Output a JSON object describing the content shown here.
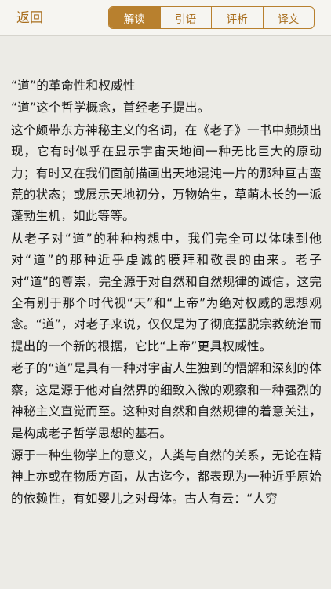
{
  "header": {
    "back_label": "返回",
    "tabs": [
      {
        "label": "解读",
        "active": true
      },
      {
        "label": "引语",
        "active": false
      },
      {
        "label": "评析",
        "active": false
      },
      {
        "label": "译文",
        "active": false
      }
    ]
  },
  "article": {
    "paragraphs": [
      "“道”的革命性和权威性",
      "“道”这个哲学概念，首经老子提出。",
      "这个颇带东方神秘主义的名词，在《老子》一书中频频出现，它有时似乎在显示宇宙天地间一种无比巨大的原动力；有时又在我们面前描画出天地混沌一片的那种亘古蛮荒的状态；或展示天地初分，万物始生，草萌木长的一派蓬勃生机，如此等等。",
      "从老子对“道”的种种构想中，我们完全可以体味到他对“道”的那种近乎虔诚的膜拜和敬畏的由来。老子对“道”的尊崇，完全源于对自然和自然规律的诚信，这完全有别于那个时代视“天”和“上帝”为绝对权威的思想观念。“道”，对老子来说，仅仅是为了彻底摆脱宗教统治而提出的一个新的根据，它比“上帝”更具权威性。",
      "老子的“道”是具有一种对宇宙人生独到的悟解和深刻的体察，这是源于他对自然界的细致入微的观察和一种强烈的神秘主义直觉而至。这种对自然和自然规律的着意关注，是构成老子哲学思想的基石。",
      "源于一种生物学上的意义，人类与自然的关系，无论在精神上亦或在物质方面，从古迄今，都表现为一种近乎原始的依赖性，有如婴儿之对母体。古人有云：“人穷"
    ]
  },
  "colors": {
    "accent": "#b8802e",
    "accent_text": "#a86d1c",
    "background": "#ecebe6",
    "bar_background": "#f6f5f1"
  }
}
